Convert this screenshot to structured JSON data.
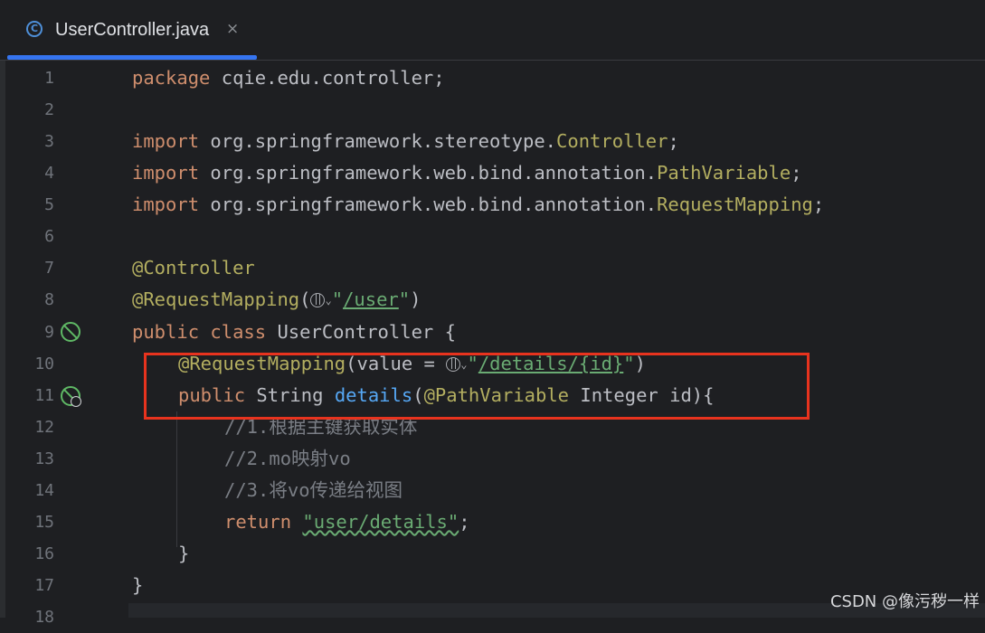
{
  "tab": {
    "title": "UserController.java",
    "icon": "java-class-icon",
    "close_label": "×"
  },
  "gutter": {
    "line_numbers": [
      "1",
      "2",
      "3",
      "4",
      "5",
      "6",
      "7",
      "8",
      "9",
      "10",
      "11",
      "12",
      "13",
      "14",
      "15",
      "16",
      "17",
      "18"
    ]
  },
  "code": {
    "l1_kw": "package",
    "l1_rest": " cqie.edu.controller;",
    "l3_kw": "import",
    "l3_pkg": " org.springframework.stereotype.",
    "l3_cls": "Controller",
    "l3_end": ";",
    "l4_kw": "import",
    "l4_pkg": " org.springframework.web.bind.annotation.",
    "l4_cls": "PathVariable",
    "l4_end": ";",
    "l5_kw": "import",
    "l5_pkg": " org.springframework.web.bind.annotation.",
    "l5_cls": "RequestMapping",
    "l5_end": ";",
    "l7_ann": "@Controller",
    "l8_ann": "@RequestMapping",
    "l8_open": "(",
    "l8_q1": "\"",
    "l8_path": "/user",
    "l8_q2": "\"",
    "l8_close": ")",
    "l9_kw1": "public",
    "l9_kw2": " class",
    "l9_rest": " UserController {",
    "l10_ann": "@RequestMapping",
    "l10_mid": "(value = ",
    "l10_q1": "\"",
    "l10_path": "/details/{id}",
    "l10_q2": "\"",
    "l10_close": ")",
    "l11_kw": "public",
    "l11_type": " String ",
    "l11_fn": "details",
    "l11_open": "(",
    "l11_ann": "@PathVariable",
    "l11_rest": " Integer ",
    "l11_param": "id",
    "l11_end": "){",
    "l12": "//1.根据主键获取实体",
    "l13": "//2.mo映射vo",
    "l14": "//3.将vo传递给视图",
    "l15_kw": "return",
    "l15_sp": " ",
    "l15_str": "\"user/details\"",
    "l15_end": ";",
    "l16": "}",
    "l17": "}"
  },
  "watermark": "CSDN @像污秽一样"
}
